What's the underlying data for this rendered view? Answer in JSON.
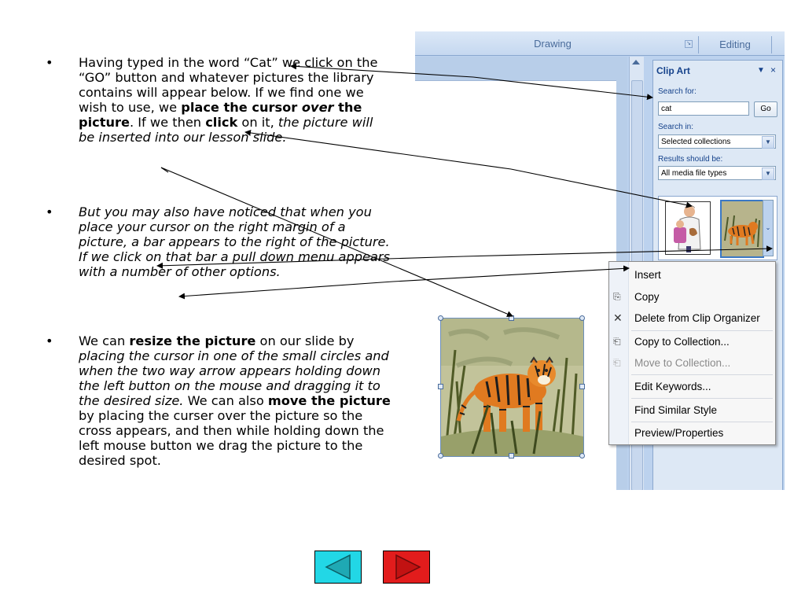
{
  "bullets": {
    "symbol": "•",
    "b1": {
      "t1": "Having typed in the word “Cat” we click on the “GO” button and whatever pictures the library contains will appear below.  If we find one we wish to use, we ",
      "t2": "place the cursor ",
      "t3": "over",
      "t4": " the picture",
      "t5": ".  If we then ",
      "t6": "click",
      "t7": " on it, ",
      "t8": "the picture will be inserted into our lesson slide."
    },
    "b2": {
      "t1": "But you may also have noticed that when you place your cursor on the right margin of a picture, a bar appears to the right of the picture.  If we click on that bar a pull down menu appears with a number of other options."
    },
    "b3": {
      "t1": "We can ",
      "t2": "resize the picture",
      "t3": " on our slide by ",
      "t4": "placing the cursor in one of the small circles and when the two way arrow appears holding down the left button on the mouse and dragging it to the desired size.",
      "t5": "  We can also ",
      "t6": "move the picture",
      "t7": " by placing the curser over the picture so the cross appears, and then while holding down the left mouse button we drag the picture to the desired spot."
    }
  },
  "ribbon": {
    "drawing_label": "Drawing",
    "launcher_glyph": "↘",
    "editing_label": "Editing"
  },
  "clipart_pane": {
    "title": "Clip Art",
    "menu_glyph": "▼",
    "close_glyph": "×",
    "search_for_label": "Search for:",
    "search_value": "cat",
    "go_label": "Go",
    "search_in_label": "Search in:",
    "search_in_value": "Selected collections",
    "results_label": "Results should be:",
    "results_value": "All media file types",
    "dropdown_glyph": "▼",
    "thumbbar_glyph": "⌄"
  },
  "context_menu": {
    "insert": "Insert",
    "copy": "Copy",
    "delete": "Delete from Clip Organizer",
    "copy_to": "Copy to Collection...",
    "move_to": "Move to Collection...",
    "edit_keywords": "Edit Keywords...",
    "find_similar": "Find Similar Style",
    "preview": "Preview/Properties"
  },
  "icons": {
    "copy": "⎘",
    "delete": "✕",
    "copy_to": "⎗",
    "move_to": "⎗"
  },
  "colors": {
    "prev_button": "#22d7e6",
    "next_button": "#e21c1c"
  }
}
